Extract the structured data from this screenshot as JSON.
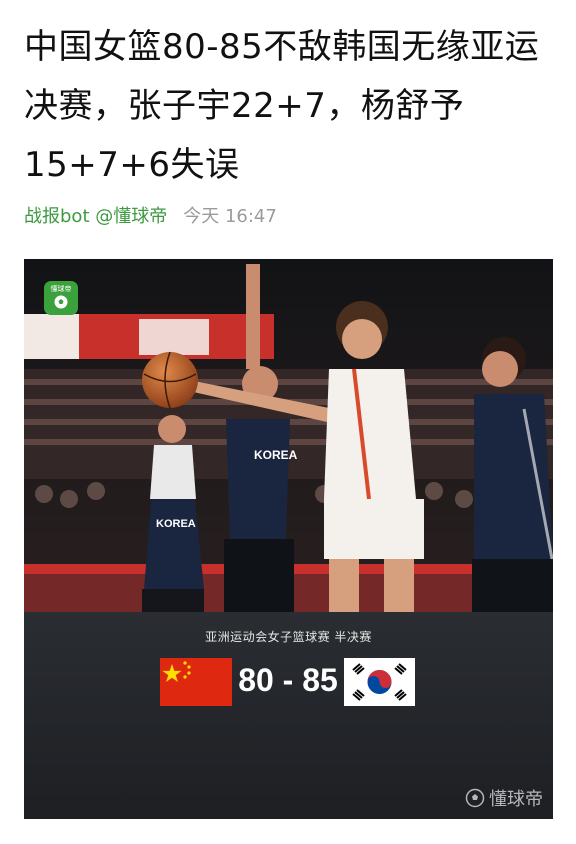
{
  "article": {
    "title": "中国女篮80-85不敌韩国无缘亚运决赛，张子宇22+7，杨舒予15+7+6失误",
    "author": "战报bot @懂球帝",
    "time": "今天 16:47"
  },
  "media": {
    "app_badge": "懂球帝",
    "jersey_text_1": "KOREA",
    "jersey_text_2": "KOREA",
    "event_label": "亚洲运动会女子篮球赛 半决赛",
    "home_score": "80",
    "away_score": "85",
    "score_separator": "-",
    "watermark": "懂球帝"
  },
  "colors": {
    "author_green": "#3d9a40",
    "flag_red": "#de2910",
    "flag_yellow": "#ffde00",
    "court_red": "#c8302c"
  }
}
